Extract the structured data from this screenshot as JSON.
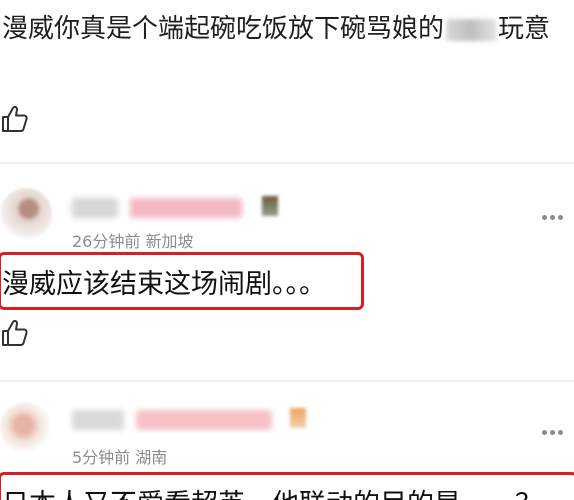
{
  "top_comment": {
    "text_before": "漫威你真是个端起碗吃饭放下碗骂娘的",
    "text_after": "玩意"
  },
  "comments": [
    {
      "meta": "26分钟前 新加坡",
      "text": "漫威应该结束这场闹剧。。。"
    },
    {
      "meta": "5分钟前 湖南",
      "text": "日本人又不爱看超英，他联动的目的是……？"
    }
  ],
  "icons": {
    "like": "thumbs-up-icon",
    "more": "more-dots-icon"
  },
  "colors": {
    "highlight": "#d81e1e",
    "meta_text": "#8c8c8c",
    "divider": "#eeeeee"
  }
}
